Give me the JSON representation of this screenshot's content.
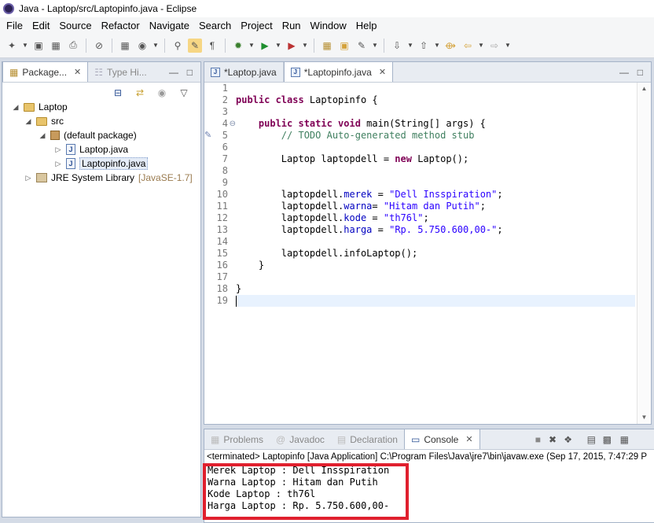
{
  "window": {
    "title": "Java - Laptop/src/Laptopinfo.java - Eclipse"
  },
  "menu": [
    "File",
    "Edit",
    "Source",
    "Refactor",
    "Navigate",
    "Search",
    "Project",
    "Run",
    "Window",
    "Help"
  ],
  "package_explorer": {
    "tabs": [
      {
        "label": "Package...",
        "active": true
      },
      {
        "label": "Type Hi...",
        "active": false
      }
    ],
    "tree": {
      "project": "Laptop",
      "src": "src",
      "package": "(default package)",
      "files": [
        "Laptop.java",
        "Laptopinfo.java"
      ],
      "library": "JRE System Library",
      "library_version": "[JavaSE-1.7]"
    }
  },
  "editor": {
    "tabs": [
      {
        "label": "*Laptop.java",
        "active": false
      },
      {
        "label": "*Laptopinfo.java",
        "active": true
      }
    ],
    "line_numbers": [
      "1",
      "2",
      "3",
      "4",
      "5",
      "6",
      "7",
      "8",
      "9",
      "10",
      "11",
      "12",
      "13",
      "14",
      "15",
      "16",
      "17",
      "18",
      "19"
    ],
    "lines": {
      "l2_kw": "public class",
      "l2_rest": " Laptopinfo {",
      "l4_kw": "    public static void",
      "l4_rest": " main(String[] args) {",
      "l5": "        // TODO Auto-generated method stub",
      "l7_a": "        Laptop laptopdell = ",
      "l7_kw": "new",
      "l7_b": " Laptop();",
      "l10_a": "        laptopdell.",
      "l10_f": "merek",
      "l10_b": " = ",
      "l10_s": "\"Dell Insspiration\"",
      "l10_c": ";",
      "l11_a": "        laptopdell.",
      "l11_f": "warna",
      "l11_b": "= ",
      "l11_s": "\"Hitam dan Putih\"",
      "l11_c": ";",
      "l12_a": "        laptopdell.",
      "l12_f": "kode",
      "l12_b": " = ",
      "l12_s": "\"th76l\"",
      "l12_c": ";",
      "l13_a": "        laptopdell.",
      "l13_f": "harga",
      "l13_b": " = ",
      "l13_s": "\"Rp. 5.750.600,00-\"",
      "l13_c": ";",
      "l15": "        laptopdell.infoLaptop();",
      "l16": "    }",
      "l18": "}"
    }
  },
  "console": {
    "tabs": [
      {
        "label": "Problems",
        "active": false
      },
      {
        "label": "Javadoc",
        "active": false
      },
      {
        "label": "Declaration",
        "active": false
      },
      {
        "label": "Console",
        "active": true
      }
    ],
    "status": "<terminated> Laptopinfo [Java Application] C:\\Program Files\\Java\\jre7\\bin\\javaw.exe (Sep 17, 2015, 7:47:29 P",
    "output": [
      "Merek Laptop : Dell Insspiration",
      "Warna Laptop : Hitam dan Putih",
      "Kode Laptop : th76l",
      "Harga Laptop : Rp. 5.750.600,00-"
    ]
  },
  "highlight_color": "#e0202e"
}
